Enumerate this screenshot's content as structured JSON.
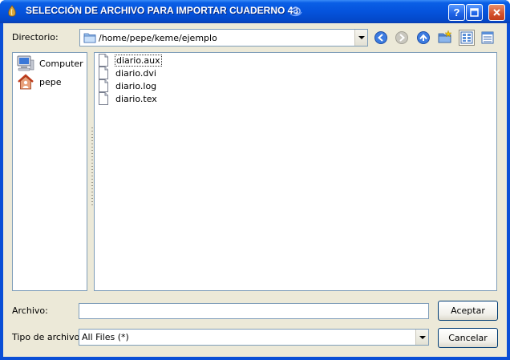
{
  "window": {
    "title": "SELECCIÓN DE ARCHIVO PARA IMPORTAR CUADERNO 43",
    "help_label": "?",
    "maximize_label": "□",
    "close_label": "✕"
  },
  "directory": {
    "label": "Directorio:",
    "path": "/home/pepe/keme/ejemplo"
  },
  "toolbar": {
    "icons": [
      "back-icon",
      "forward-icon",
      "up-icon",
      "new-folder-icon",
      "list-view-icon",
      "detail-view-icon"
    ],
    "active_view": "list-view"
  },
  "places": [
    {
      "label": "Computer",
      "icon": "computer-icon"
    },
    {
      "label": "pepe",
      "icon": "home-icon"
    }
  ],
  "files": [
    {
      "name": "diario.aux",
      "focused": true
    },
    {
      "name": "diario.dvi",
      "focused": false
    },
    {
      "name": "diario.log",
      "focused": false
    },
    {
      "name": "diario.tex",
      "focused": false
    }
  ],
  "filename": {
    "label": "Archivo:",
    "value": ""
  },
  "filetype": {
    "label": "Tipo de archivo:",
    "selected": "All Files (*)"
  },
  "buttons": {
    "accept": "Aceptar",
    "cancel": "Cancelar"
  },
  "colors": {
    "titlebar": "#0553dc",
    "dialog_bg": "#ece9d8",
    "close_button": "#d4502c"
  }
}
